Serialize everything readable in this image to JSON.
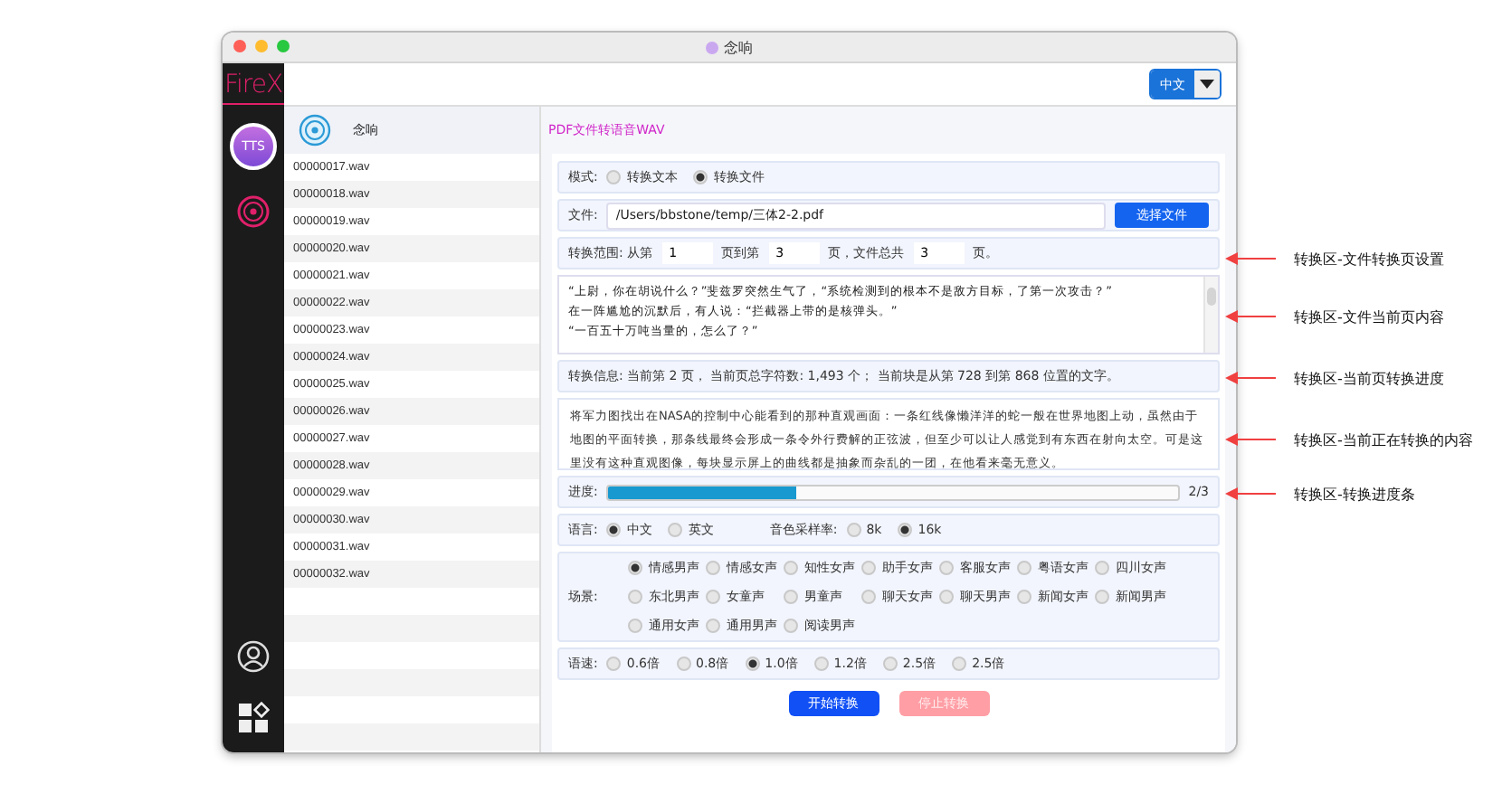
{
  "window": {
    "title": "念响"
  },
  "logo": "FireX",
  "sidebar": {
    "items": [
      {
        "kind": "tts",
        "label": "TTS",
        "selected": true
      },
      {
        "kind": "disc",
        "selected": false
      }
    ],
    "bottom": [
      {
        "kind": "user"
      },
      {
        "kind": "apps"
      }
    ]
  },
  "language_select": {
    "value": "中文"
  },
  "file_list": {
    "title": "念响",
    "items": [
      "00000017.wav",
      "00000018.wav",
      "00000019.wav",
      "00000020.wav",
      "00000021.wav",
      "00000022.wav",
      "00000023.wav",
      "00000024.wav",
      "00000025.wav",
      "00000026.wav",
      "00000027.wav",
      "00000028.wav",
      "00000029.wav",
      "00000030.wav",
      "00000031.wav",
      "00000032.wav"
    ]
  },
  "main": {
    "title": "PDF文件转语音WAV",
    "mode": {
      "label": "模式:",
      "options": [
        {
          "label": "转换文本",
          "selected": false
        },
        {
          "label": "转换文件",
          "selected": true
        }
      ]
    },
    "file": {
      "label": "文件:",
      "value": "/Users/bbstone/temp/三体2-2.pdf",
      "button": "选择文件"
    },
    "range": {
      "label": "转换范围: 从第",
      "from": "1",
      "mid": "页到第",
      "to": "3",
      "total_label": "页，文件总共",
      "total": "3",
      "end": "页。"
    },
    "page_text": [
      "“上尉，你在胡说什么？”斐兹罗突然生气了，“系统检测到的根本不是敌方目标，了第一次攻击？”",
      "在一阵尴尬的沉默后，有人说：“拦截器上带的是核弹头。”",
      "“一百五十万吨当量的，怎么了？”"
    ],
    "info": "转换信息:  当前第 2 页，  当前页总字符数: 1,493 个；  当前块是从第 728 到第 868 位置的文字。",
    "current_text": "将军力图找出在NASA的控制中心能看到的那种直观画面：一条红线像懒洋洋的蛇一般在世界地图上动，虽然由于地图的平面转换，那条线最终会形成一条令外行费解的正弦波，但至少可以让人感觉到有东西在射向太空。可是这里没有这种直观图像，每块显示屏上的曲线都是抽象而杂乱的一团，在他看来毫无意义。",
    "progress": {
      "label": "进度:",
      "level": 0.33,
      "reading": "2/3"
    },
    "language": {
      "label": "语言:",
      "options": [
        {
          "label": "中文",
          "selected": true
        },
        {
          "label": "英文",
          "selected": false
        }
      ]
    },
    "sample_rate": {
      "label": "音色采样率:",
      "options": [
        {
          "label": "8k",
          "selected": false
        },
        {
          "label": "16k",
          "selected": true
        }
      ]
    },
    "scene": {
      "label": "场景:",
      "options": [
        {
          "label": "情感男声",
          "selected": true
        },
        {
          "label": "情感女声",
          "selected": false
        },
        {
          "label": "知性女声",
          "selected": false
        },
        {
          "label": "助手女声",
          "selected": false
        },
        {
          "label": "客服女声",
          "selected": false
        },
        {
          "label": "粤语女声",
          "selected": false
        },
        {
          "label": "四川女声",
          "selected": false
        },
        {
          "label": "东北男声",
          "selected": false
        },
        {
          "label": "女童声",
          "selected": false
        },
        {
          "label": "男童声",
          "selected": false
        },
        {
          "label": "聊天女声",
          "selected": false
        },
        {
          "label": "聊天男声",
          "selected": false
        },
        {
          "label": "新闻女声",
          "selected": false
        },
        {
          "label": "新闻男声",
          "selected": false
        },
        {
          "label": "通用女声",
          "selected": false
        },
        {
          "label": "通用男声",
          "selected": false
        },
        {
          "label": "阅读男声",
          "selected": false
        }
      ]
    },
    "speed": {
      "label": "语速:",
      "options": [
        {
          "label": "0.6倍",
          "selected": false
        },
        {
          "label": "0.8倍",
          "selected": false
        },
        {
          "label": "1.0倍",
          "selected": true
        },
        {
          "label": "1.2倍",
          "selected": false
        },
        {
          "label": "2.5倍",
          "selected": false
        },
        {
          "label": "2.5倍",
          "selected": false
        }
      ]
    },
    "buttons": [
      {
        "label": "开始转换",
        "disabled": false
      },
      {
        "label": "停止转换",
        "disabled": true
      }
    ]
  },
  "annotations": [
    "转换区-文件转换页设置",
    "转换区-文件当前页内容",
    "转换区-当前页转换进度",
    "转换区-当前正在转换的内容",
    "转换区-转换进度条"
  ]
}
